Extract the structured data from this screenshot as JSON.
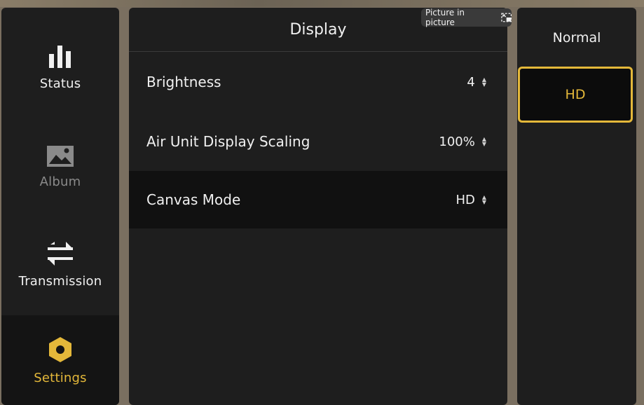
{
  "sidebar": {
    "items": [
      {
        "label": "Status",
        "icon": "bar-chart-icon"
      },
      {
        "label": "Album",
        "icon": "image-icon"
      },
      {
        "label": "Transmission",
        "icon": "transfer-arrows-icon"
      },
      {
        "label": "Settings",
        "icon": "hexagon-gear-icon"
      }
    ]
  },
  "main": {
    "title": "Display",
    "rows": [
      {
        "label": "Brightness",
        "value": "4"
      },
      {
        "label": "Air Unit Display Scaling",
        "value": "100%"
      },
      {
        "label": "Canvas Mode",
        "value": "HD"
      }
    ]
  },
  "options": {
    "items": [
      {
        "label": "Normal"
      },
      {
        "label": "HD"
      }
    ]
  },
  "overlay": {
    "pip_label": "Picture in picture"
  },
  "colors": {
    "accent": "#e4b83a",
    "panel": "#1e1e1e",
    "selected_row": "#111111",
    "text": "#f0f0f0",
    "disabled_text": "#8a8a8a"
  }
}
